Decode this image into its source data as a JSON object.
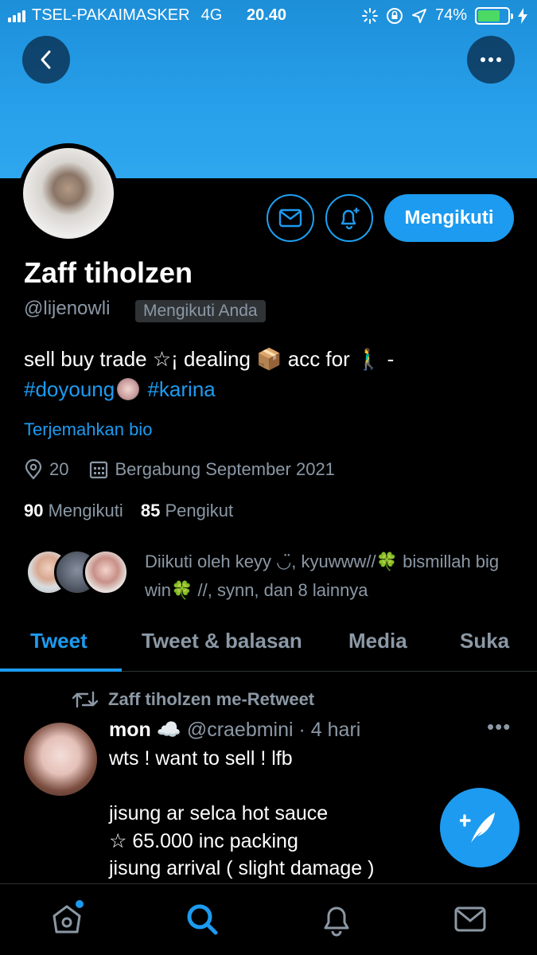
{
  "status_bar": {
    "carrier": "TSEL-PAKAIMASKER",
    "network": "4G",
    "time": "20.40",
    "battery": "74%",
    "battery_level": 0.74
  },
  "profile": {
    "name": "Zaff tiholzen",
    "handle": "@lijenowli",
    "follows_you_badge": "Mengikuti Anda",
    "follow_button": "Mengikuti",
    "bio_line1": "sell buy trade ☆¡ dealing 📦 acc for 🚶‍♂️ -",
    "bio_tag1": "#doyoung",
    "bio_tag2": "#karina",
    "translate_bio": "Terjemahkan bio",
    "location": "20",
    "joined": "Bergabung September 2021",
    "following_count": "90",
    "following_label": "Mengikuti",
    "followers_count": "85",
    "followers_label": "Pengikut",
    "followed_by_text": "Diikuti oleh keyy ◡̈, kyuwww//🍀 bismillah big win🍀 //, synn, dan 8 lainnya"
  },
  "tabs": [
    {
      "label": "Tweet",
      "active": true
    },
    {
      "label": "Tweet & balasan",
      "active": false
    },
    {
      "label": "Media",
      "active": false
    },
    {
      "label": "Suka",
      "active": false
    }
  ],
  "tweet": {
    "retweet_label": "Zaff tiholzen me-Retweet",
    "author": "mon ☁️",
    "meta": "@craebmini · 4 hari",
    "body": "wts ! want to sell ! lfb\n\njisung ar selca hot sauce\n☆ 65.000 inc packing\njisung arrival ( slight damage )"
  },
  "bottom_nav": [
    "home-icon",
    "search-icon",
    "bell-icon",
    "mail-icon"
  ],
  "colors": {
    "accent": "#1d9bf0",
    "muted": "#8b98a5",
    "background": "#000000",
    "banner": "#2ea7ef"
  }
}
